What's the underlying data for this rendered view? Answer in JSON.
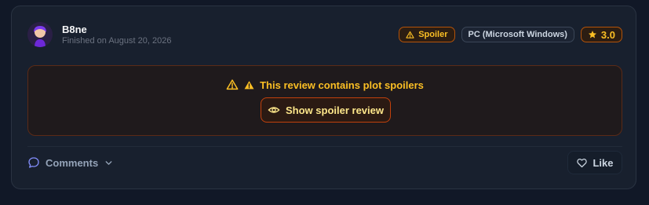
{
  "review": {
    "username": "B8ne",
    "finished": "Finished on August 20, 2026",
    "badges": {
      "spoiler": "Spoiler",
      "platform": "PC (Microsoft Windows)",
      "rating": "3.0"
    },
    "spoiler_notice": "This review contains plot spoilers",
    "show_button": "Show spoiler review",
    "comments_label": "Comments",
    "like_label": "Like"
  },
  "icons": {
    "avatar": "avatar",
    "spoiler_badge": "warning-triangle-icon",
    "rating": "star-icon",
    "notice_outline": "warning-triangle-icon",
    "notice_filled": "warning-triangle-filled-icon",
    "show": "eye-icon",
    "comments": "speech-bubble-icon",
    "toggle": "chevron-down-icon",
    "like": "heart-icon"
  },
  "colors": {
    "background": "#111827",
    "card": "#18202e",
    "accent_amber": "#fbbf24",
    "spoiler_border": "#c2410c",
    "comment_icon": "#818cf8"
  }
}
